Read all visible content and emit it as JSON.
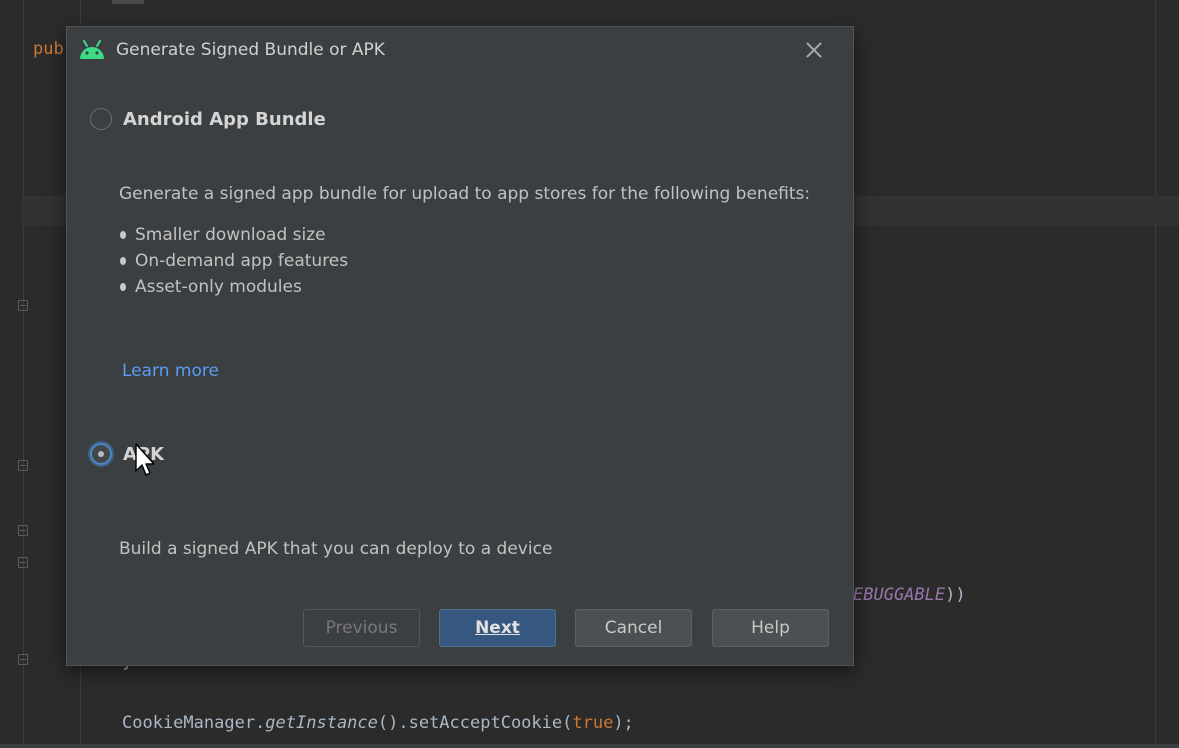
{
  "editor": {
    "keyword_fragment": "pub",
    "constant_fragment": "EBUGGABLE",
    "constant_tail": "))",
    "closing_brace": "}",
    "code_line": {
      "class_name": "CookieManager.",
      "method": "getInstance",
      "middle": "().setAcceptCookie(",
      "arg": "true",
      "end": ");"
    }
  },
  "dialog": {
    "title": "Generate Signed Bundle or APK",
    "options": [
      {
        "label": "Android App Bundle",
        "selected": false,
        "description": "Generate a signed app bundle for upload to app stores for the following benefits:",
        "benefits": [
          "Smaller download size",
          "On-demand app features",
          "Asset-only modules"
        ],
        "link": "Learn more"
      },
      {
        "label": "APK",
        "selected": true,
        "description": "Build a signed APK that you can deploy to a device"
      }
    ],
    "buttons": {
      "previous": "Previous",
      "next": "Next",
      "cancel": "Cancel",
      "help": "Help"
    }
  },
  "colors": {
    "editor_bg": "#2b2b2b",
    "dialog_bg": "#3c3f41",
    "accent": "#365880",
    "link": "#589df6",
    "android_green": "#3ddc84"
  },
  "icons": [
    "android-icon",
    "close-icon",
    "mouse-cursor-icon"
  ]
}
